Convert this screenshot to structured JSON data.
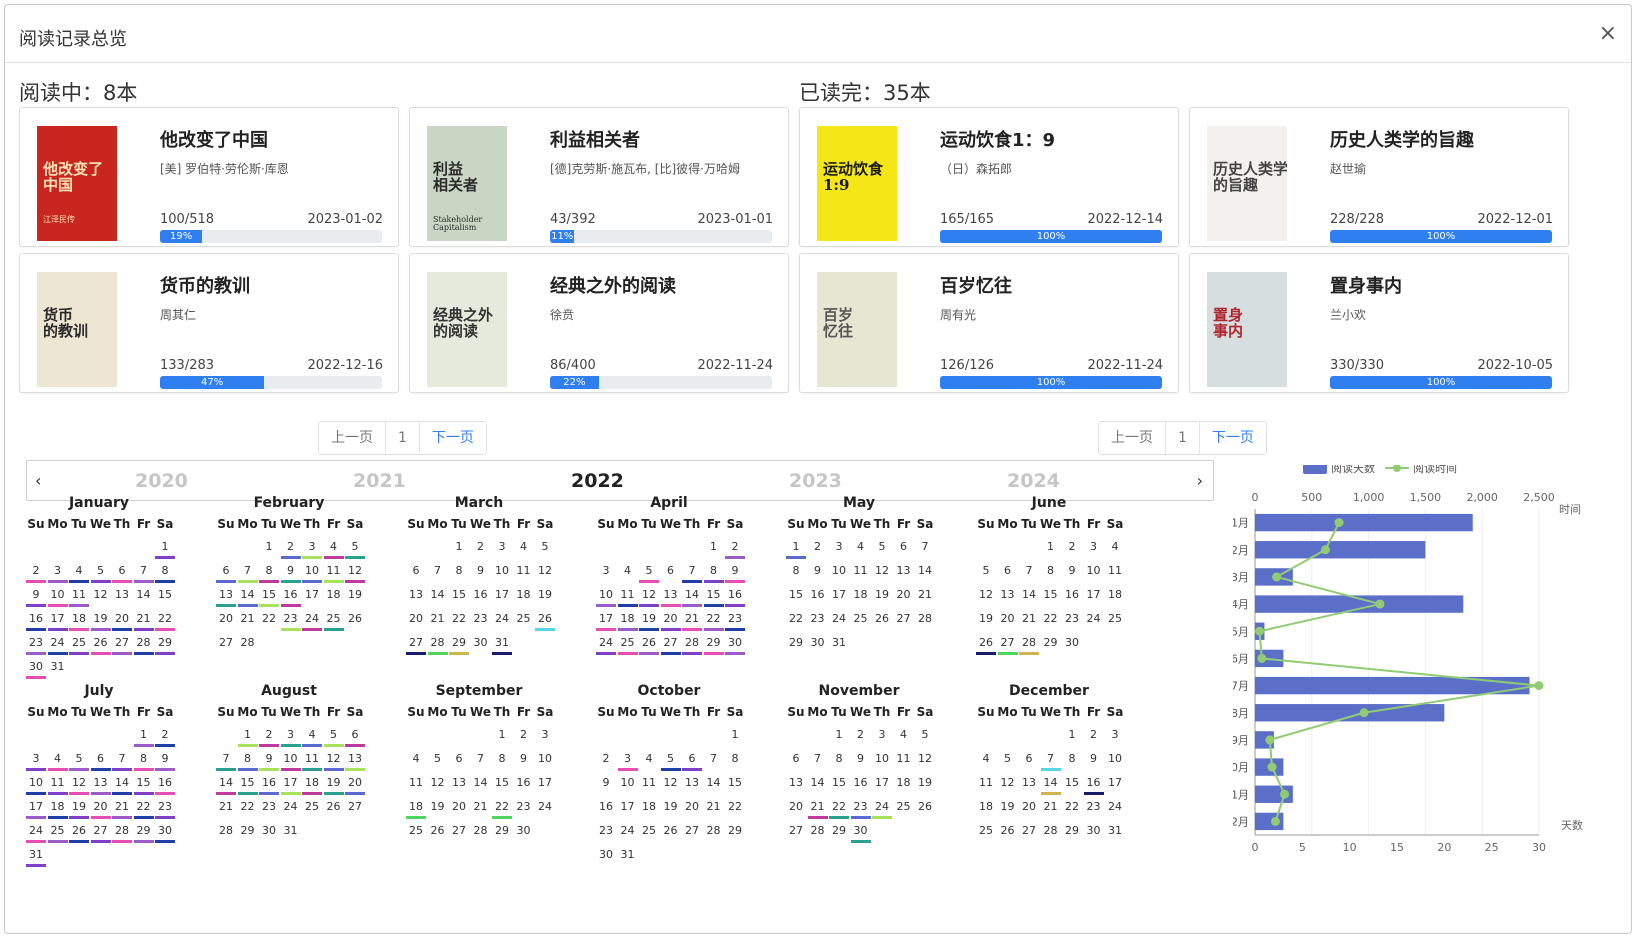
{
  "modal": {
    "title": "阅读记录总览",
    "close": "×"
  },
  "reading": {
    "header": "阅读中：8本",
    "pager": {
      "prev": "上一页",
      "page": "1",
      "next": "下一页"
    },
    "books": [
      {
        "title": "他改变了中国",
        "author": "[美] 罗伯特·劳伦斯·库恩",
        "progress": "100/518",
        "date": "2023-01-02",
        "percent": 19,
        "percent_label": "19%",
        "cover": {
          "bg": "#c8261f",
          "text": "他改变了\n中国",
          "sub": "江泽民传",
          "fg": "#fde4b8"
        }
      },
      {
        "title": "利益相关者",
        "author": "[德]克劳斯·施瓦布, [比]彼得·万哈姆",
        "progress": "43/392",
        "date": "2023-01-01",
        "percent": 11,
        "percent_label": "11%",
        "cover": {
          "bg": "#c9d6c4",
          "text": "利益\n相关者",
          "sub": "Stakeholder Capitalism",
          "fg": "#2b2b2b"
        }
      },
      {
        "title": "货币的教训",
        "author": "周其仁",
        "progress": "133/283",
        "date": "2022-12-16",
        "percent": 47,
        "percent_label": "47%",
        "cover": {
          "bg": "#ede6d3",
          "text": "货币\n的教训",
          "sub": "",
          "fg": "#2a2a2a"
        }
      },
      {
        "title": "经典之外的阅读",
        "author": "徐贲",
        "progress": "86/400",
        "date": "2022-11-24",
        "percent": 22,
        "percent_label": "22%",
        "cover": {
          "bg": "#e6eadc",
          "text": "经典之外\n的阅读",
          "sub": "",
          "fg": "#333333"
        }
      }
    ]
  },
  "finished": {
    "header": "已读完：35本",
    "pager": {
      "prev": "上一页",
      "page": "1",
      "next": "下一页"
    },
    "books": [
      {
        "title": "运动饮食1：9",
        "author": "（日）森拓郎",
        "progress": "165/165",
        "date": "2022-12-14",
        "percent": 100,
        "percent_label": "100%",
        "cover": {
          "bg": "#f5e617",
          "text": "运动饮食\n1:9",
          "sub": "",
          "fg": "#1a1a1a"
        }
      },
      {
        "title": "历史人类学的旨趣",
        "author": "赵世瑜",
        "progress": "228/228",
        "date": "2022-12-01",
        "percent": 100,
        "percent_label": "100%",
        "cover": {
          "bg": "#f3f1ee",
          "text": "历史人类学\n的旨趣",
          "sub": "",
          "fg": "#444444"
        }
      },
      {
        "title": "百岁忆往",
        "author": "周有光",
        "progress": "126/126",
        "date": "2022-11-24",
        "percent": 100,
        "percent_label": "100%",
        "cover": {
          "bg": "#e5e7d2",
          "text": "百岁\n忆往",
          "sub": "",
          "fg": "#555555"
        }
      },
      {
        "title": "置身事内",
        "author": "兰小欢",
        "progress": "330/330",
        "date": "2022-10-05",
        "percent": 100,
        "percent_label": "100%",
        "cover": {
          "bg": "#d7dee0",
          "text": "置身\n事内",
          "sub": "",
          "fg": "#b1262e"
        }
      }
    ]
  },
  "calendar": {
    "years": [
      "2020",
      "2021",
      "2022",
      "2023",
      "2024"
    ],
    "current_year": "2022",
    "prev": "‹",
    "next": "›",
    "weekdays": [
      "Su",
      "Mo",
      "Tu",
      "We",
      "Th",
      "Fr",
      "Sa"
    ],
    "months": [
      {
        "name": "January",
        "start": 6,
        "days": 31
      },
      {
        "name": "February",
        "start": 2,
        "days": 28
      },
      {
        "name": "March",
        "start": 2,
        "days": 31
      },
      {
        "name": "April",
        "start": 5,
        "days": 30
      },
      {
        "name": "May",
        "start": 0,
        "days": 31
      },
      {
        "name": "June",
        "start": 3,
        "days": 30
      },
      {
        "name": "July",
        "start": 5,
        "days": 31
      },
      {
        "name": "August",
        "start": 1,
        "days": 31
      },
      {
        "name": "September",
        "start": 4,
        "days": 30
      },
      {
        "name": "October",
        "start": 6,
        "days": 31
      },
      {
        "name": "November",
        "start": 2,
        "days": 30
      },
      {
        "name": "December",
        "start": 4,
        "days": 31
      }
    ],
    "marked_days": [
      [
        1,
        2,
        3,
        4,
        5,
        6,
        7,
        8,
        9,
        10,
        11,
        16,
        17,
        18,
        19,
        20,
        21,
        22,
        23,
        24,
        25,
        26,
        27,
        28,
        29,
        30
      ],
      [
        2,
        3,
        4,
        5,
        6,
        7,
        8,
        9,
        10,
        11,
        12,
        13,
        14,
        15,
        16,
        23,
        24,
        25
      ],
      [
        26,
        27,
        28,
        29,
        31
      ],
      [
        2,
        5,
        7,
        8,
        9,
        10,
        11,
        12,
        13,
        14,
        15,
        16,
        17,
        18,
        19,
        20,
        21,
        22,
        23,
        24,
        25,
        26,
        27,
        28,
        29,
        30
      ],
      [
        1
      ],
      [
        26,
        27,
        28
      ],
      [
        1,
        2,
        3,
        4,
        5,
        6,
        7,
        8,
        9,
        10,
        11,
        12,
        13,
        14,
        15,
        16,
        17,
        18,
        19,
        20,
        21,
        22,
        23,
        24,
        25,
        26,
        27,
        28,
        29,
        30,
        31
      ],
      [
        1,
        2,
        3,
        4,
        5,
        6,
        7,
        8,
        9,
        10,
        11,
        12,
        13,
        14,
        15,
        16,
        17,
        18,
        19,
        20
      ],
      [
        18,
        22
      ],
      [
        3,
        5,
        6
      ],
      [
        21,
        22,
        23,
        24,
        30
      ],
      [
        7,
        14,
        16
      ]
    ],
    "mark_colors": [
      "#1f3ea8",
      "#c0399d",
      "#4fd65f",
      "#7f3fc9",
      "#2aa08f",
      "#d0b64a",
      "#e84db4",
      "#5b6ad0",
      "#59d6e0",
      "#9b5cc9",
      "#a8e25a",
      "#1b1b6e"
    ]
  },
  "chart": {
    "legend": {
      "days": "阅读天数",
      "time": "阅读时间"
    },
    "colors": {
      "bar": "#5b6fc9",
      "line": "#91cc75"
    },
    "top_axis": {
      "label": "时间",
      "ticks": [
        "0",
        "500",
        "1,000",
        "1,500",
        "2,000",
        "2,500"
      ],
      "max": 2500
    },
    "bottom_axis": {
      "label": "天数",
      "ticks": [
        "0",
        "5",
        "10",
        "15",
        "20",
        "25",
        "30"
      ],
      "max": 30
    }
  },
  "chart_data": {
    "type": "bar",
    "orientation": "horizontal",
    "categories": [
      "1月",
      "2月",
      "3月",
      "4月",
      "5月",
      "6月",
      "7月",
      "8月",
      "9月",
      "10月",
      "11月",
      "12月"
    ],
    "series": [
      {
        "name": "阅读天数",
        "axis": "bottom",
        "values": [
          23,
          18,
          4,
          22,
          1,
          3,
          29,
          20,
          2,
          3,
          4,
          3
        ]
      },
      {
        "name": "阅读时间",
        "type": "line",
        "axis": "top",
        "values": [
          740,
          620,
          190,
          1100,
          40,
          60,
          2500,
          960,
          130,
          150,
          260,
          180
        ]
      }
    ]
  }
}
